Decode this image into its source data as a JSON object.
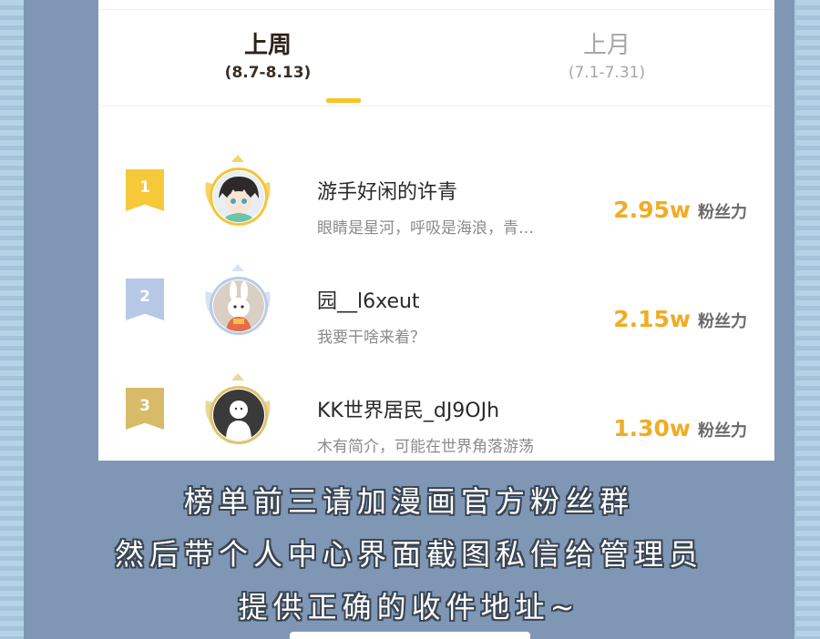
{
  "tabs": [
    {
      "name": "上周",
      "range": "(8.7-8.13)"
    },
    {
      "name": "上月",
      "range": "(7.1-7.31)"
    }
  ],
  "ranking": [
    {
      "rank": "1",
      "name": "游手好闲的许青",
      "bio": "眼睛是星河，呼吸是海浪，青…",
      "fans": "2.95w",
      "fans_unit": "粉丝力",
      "rank_color": "#f5c939",
      "avatar": "anime-boy-avatar-icon"
    },
    {
      "rank": "2",
      "name": "园__l6xeut",
      "bio": "我要干啥来着？",
      "fans": "2.15w",
      "fans_unit": "粉丝力",
      "rank_color": "#b6c8e6",
      "avatar": "bunny-avatar-icon"
    },
    {
      "rank": "3",
      "name": "KK世界居民_dJ9OJh",
      "bio": "木有简介，可能在世界角落游荡",
      "fans": "1.30w",
      "fans_unit": "粉丝力",
      "rank_color": "#d8bb68",
      "avatar": "ghost-avatar-icon"
    }
  ],
  "footer_lines": [
    "榜单前三请加漫画官方粉丝群",
    "然后带个人中心界面截图私信给管理员",
    "提供正确的收件地址~"
  ],
  "colors": {
    "accent": "#f5c623",
    "fans_number": "#f0ac24",
    "frame": "#7f97b5"
  }
}
